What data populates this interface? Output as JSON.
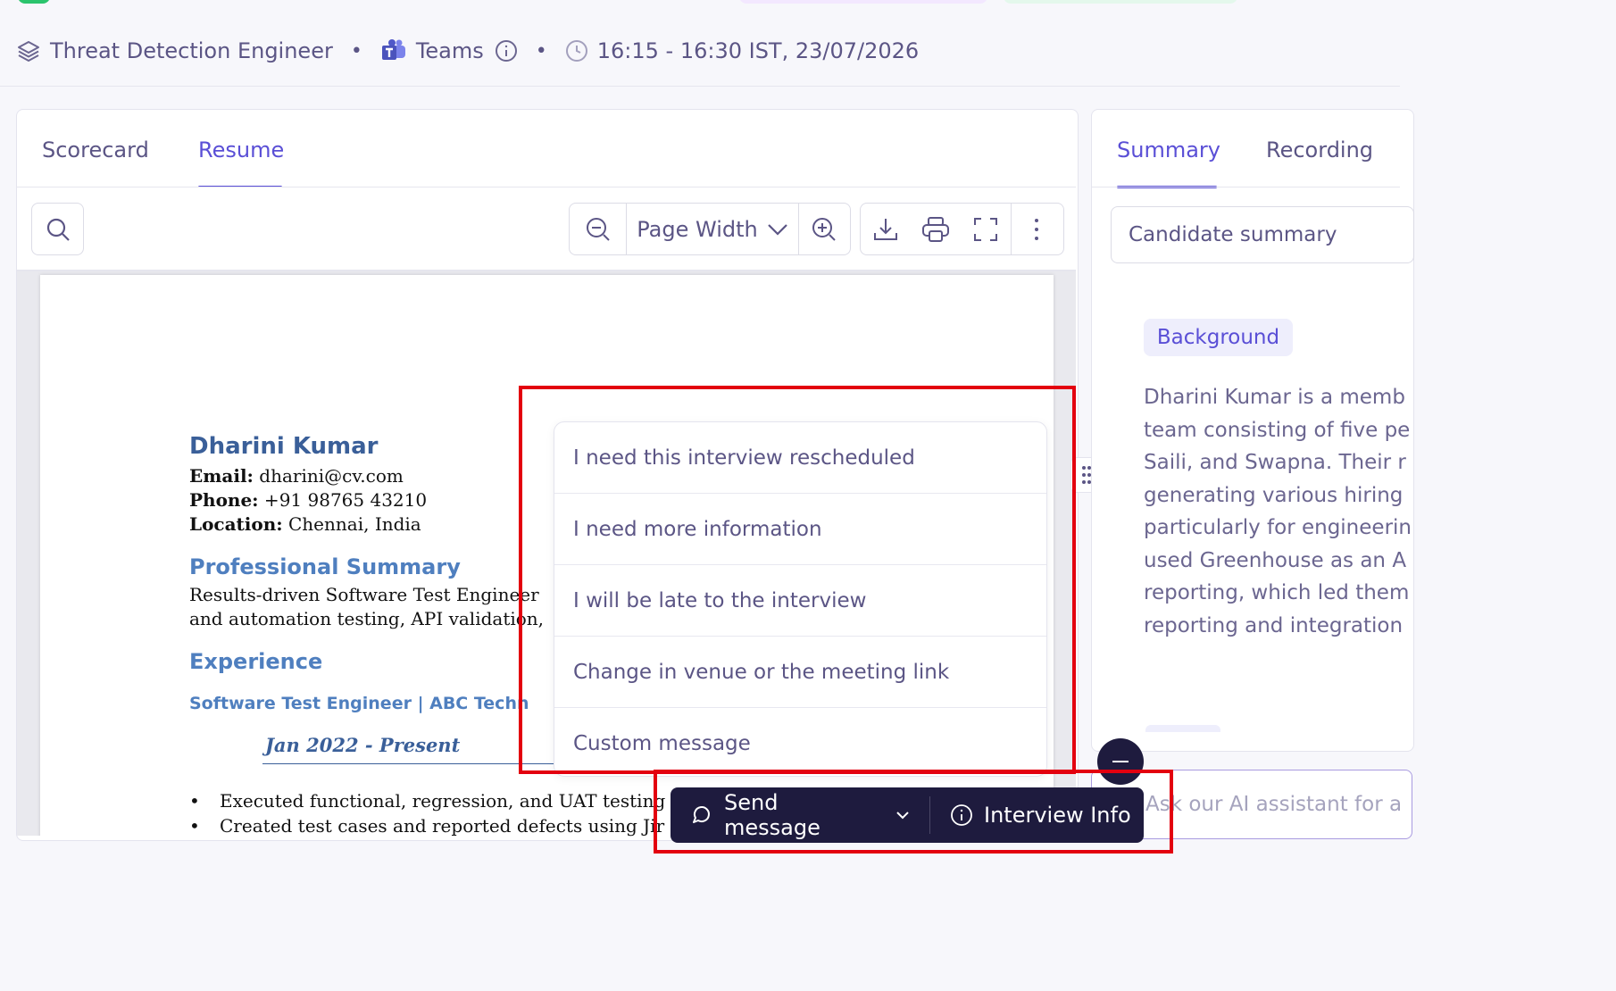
{
  "meta": {
    "role": "Threat Detection Engineer",
    "platform": "Teams",
    "time": "16:15 - 16:30 IST, 23/07/2026",
    "separator": "•"
  },
  "left_tabs": [
    "Scorecard",
    "Resume"
  ],
  "right_tabs": [
    "Summary",
    "Recording"
  ],
  "viewer_toolbar": {
    "zoom_mode": "Page Width"
  },
  "resume": {
    "name": "Dharini Kumar",
    "contact": [
      {
        "label": "Email:",
        "value": " dharini@cv.com"
      },
      {
        "label": "Phone:",
        "value": " +91 98765 43210"
      },
      {
        "label": "Location:",
        "value": " Chennai, India"
      }
    ],
    "summary_heading": "Professional Summary",
    "summary_lines": [
      "Results-driven Software Test Engineer",
      "and automation testing, API validation,"
    ],
    "experience_heading": "Experience",
    "job_title": "Software Test Engineer | ABC Techn",
    "job_dates": "Jan 2022 - Present",
    "bullets": [
      "Executed functional, regression, and UAT testing",
      "Created test cases and reported defects using Jir"
    ]
  },
  "message_options": [
    "I need this interview rescheduled",
    "I need more information",
    "I will be late to the interview",
    "Change in venue or the meeting link",
    "Custom message"
  ],
  "action_bar": {
    "send_label": "Send message",
    "info_label": "Interview Info"
  },
  "summary_panel": {
    "select_value": "Candidate summary",
    "badge": "Background",
    "text_lines": [
      "Dharini Kumar is a memb",
      "team consisting of five pe",
      "Saili, and Swapna. Their r",
      "generating various hiring",
      "particularly for engineerin",
      "used Greenhouse as an A",
      "reporting, which led them",
      "reporting and integration"
    ]
  },
  "assistant": {
    "placeholder": "Ask our AI assistant for a"
  },
  "colors": {
    "accent": "#5a4fd6",
    "text": "#5b5585",
    "dark_bar": "#1e1b3e",
    "highlight": "#e3000f"
  }
}
